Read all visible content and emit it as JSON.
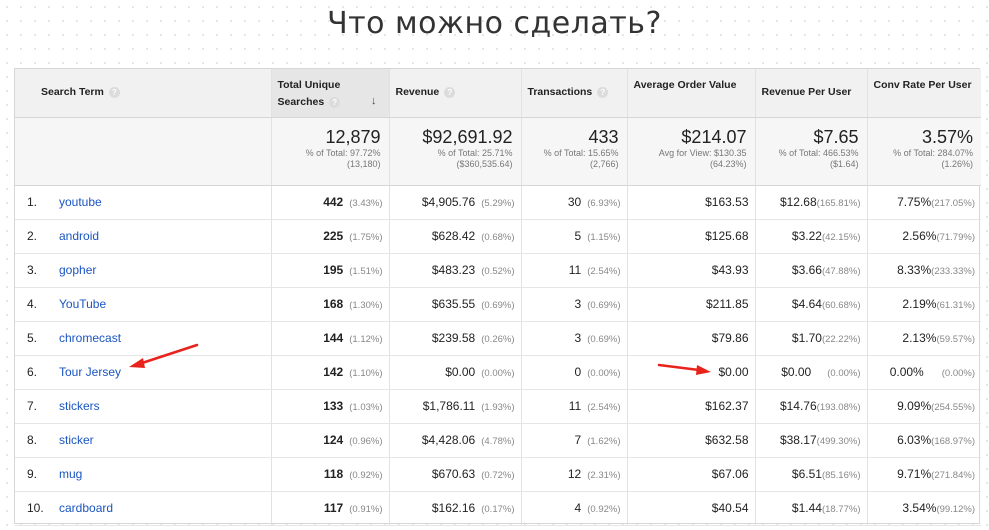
{
  "slide": {
    "title": "Что можно сделать?"
  },
  "headers": {
    "search_term": "Search Term",
    "unique_searches": "Total Unique Searches",
    "revenue": "Revenue",
    "transactions": "Transactions",
    "aov": "Average Order Value",
    "rpu": "Revenue Per User",
    "conv": "Conv Rate Per User"
  },
  "totals": {
    "unique_searches": {
      "value": "12,879",
      "sub1": "% of Total: 97.72%",
      "sub2": "(13,180)"
    },
    "revenue": {
      "value": "$92,691.92",
      "sub1": "% of Total: 25.71%",
      "sub2": "($360,535.64)"
    },
    "transactions": {
      "value": "433",
      "sub1": "% of Total: 15.65%",
      "sub2": "(2,766)"
    },
    "aov": {
      "value": "$214.07",
      "sub1": "Avg for View: $130.35",
      "sub2": "(64.23%)"
    },
    "rpu": {
      "value": "$7.65",
      "sub1": "% of Total: 466.53%",
      "sub2": "($1.64)"
    },
    "conv": {
      "value": "3.57%",
      "sub1": "% of Total: 284.07%",
      "sub2": "(1.26%)"
    }
  },
  "rows": [
    {
      "idx": "1.",
      "term": "youtube",
      "searches": "442",
      "searches_pct": "(3.43%)",
      "revenue": "$4,905.76",
      "revenue_pct": "(5.29%)",
      "transactions": "30",
      "transactions_pct": "(6.93%)",
      "aov": "$163.53",
      "rpu": "$12.68",
      "rpu_pct": "(165.81%)",
      "conv": "7.75%",
      "conv_pct": "(217.05%)"
    },
    {
      "idx": "2.",
      "term": "android",
      "searches": "225",
      "searches_pct": "(1.75%)",
      "revenue": "$628.42",
      "revenue_pct": "(0.68%)",
      "transactions": "5",
      "transactions_pct": "(1.15%)",
      "aov": "$125.68",
      "rpu": "$3.22",
      "rpu_pct": "(42.15%)",
      "conv": "2.56%",
      "conv_pct": "(71.79%)"
    },
    {
      "idx": "3.",
      "term": "gopher",
      "searches": "195",
      "searches_pct": "(1.51%)",
      "revenue": "$483.23",
      "revenue_pct": "(0.52%)",
      "transactions": "11",
      "transactions_pct": "(2.54%)",
      "aov": "$43.93",
      "rpu": "$3.66",
      "rpu_pct": "(47.88%)",
      "conv": "8.33%",
      "conv_pct": "(233.33%)"
    },
    {
      "idx": "4.",
      "term": "YouTube",
      "searches": "168",
      "searches_pct": "(1.30%)",
      "revenue": "$635.55",
      "revenue_pct": "(0.69%)",
      "transactions": "3",
      "transactions_pct": "(0.69%)",
      "aov": "$211.85",
      "rpu": "$4.64",
      "rpu_pct": "(60.68%)",
      "conv": "2.19%",
      "conv_pct": "(61.31%)"
    },
    {
      "idx": "5.",
      "term": "chromecast",
      "searches": "144",
      "searches_pct": "(1.12%)",
      "revenue": "$239.58",
      "revenue_pct": "(0.26%)",
      "transactions": "3",
      "transactions_pct": "(0.69%)",
      "aov": "$79.86",
      "rpu": "$1.70",
      "rpu_pct": "(22.22%)",
      "conv": "2.13%",
      "conv_pct": "(59.57%)"
    },
    {
      "idx": "6.",
      "term": "Tour Jersey",
      "searches": "142",
      "searches_pct": "(1.10%)",
      "revenue": "$0.00",
      "revenue_pct": "(0.00%)",
      "transactions": "0",
      "transactions_pct": "(0.00%)",
      "aov": "$0.00",
      "rpu": "$0.00",
      "rpu_pct": "(0.00%)",
      "conv": "0.00%",
      "conv_pct": "(0.00%)"
    },
    {
      "idx": "7.",
      "term": "stickers",
      "searches": "133",
      "searches_pct": "(1.03%)",
      "revenue": "$1,786.11",
      "revenue_pct": "(1.93%)",
      "transactions": "11",
      "transactions_pct": "(2.54%)",
      "aov": "$162.37",
      "rpu": "$14.76",
      "rpu_pct": "(193.08%)",
      "conv": "9.09%",
      "conv_pct": "(254.55%)"
    },
    {
      "idx": "8.",
      "term": "sticker",
      "searches": "124",
      "searches_pct": "(0.96%)",
      "revenue": "$4,428.06",
      "revenue_pct": "(4.78%)",
      "transactions": "7",
      "transactions_pct": "(1.62%)",
      "aov": "$632.58",
      "rpu": "$38.17",
      "rpu_pct": "(499.30%)",
      "conv": "6.03%",
      "conv_pct": "(168.97%)"
    },
    {
      "idx": "9.",
      "term": "mug",
      "searches": "118",
      "searches_pct": "(0.92%)",
      "revenue": "$670.63",
      "revenue_pct": "(0.72%)",
      "transactions": "12",
      "transactions_pct": "(2.31%)",
      "aov": "$67.06",
      "rpu": "$6.51",
      "rpu_pct": "(85.16%)",
      "conv": "9.71%",
      "conv_pct": "(271.84%)"
    },
    {
      "idx": "10.",
      "term": "cardboard",
      "searches": "117",
      "searches_pct": "(0.91%)",
      "revenue": "$162.16",
      "revenue_pct": "(0.17%)",
      "transactions": "4",
      "transactions_pct": "(0.92%)",
      "aov": "$40.54",
      "rpu": "$1.44",
      "rpu_pct": "(18.77%)",
      "conv": "3.54%",
      "conv_pct": "(99.12%)"
    }
  ],
  "annotations": {
    "arrow_color": "#e8231b"
  }
}
